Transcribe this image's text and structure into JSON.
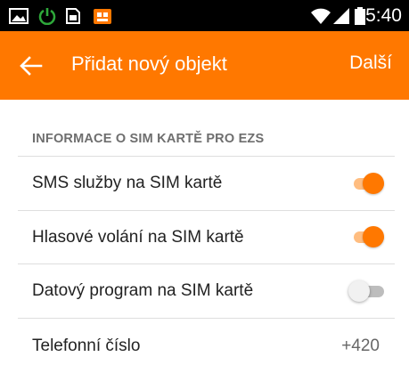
{
  "status_bar": {
    "time": "15:40",
    "icons": [
      "gallery-icon",
      "power-icon",
      "sim-icon",
      "security-icon",
      "wifi-icon",
      "signal-icon",
      "battery-icon"
    ]
  },
  "app_bar": {
    "title": "Přidat nový objekt",
    "action_label": "Další",
    "background_color": "#ff7800"
  },
  "section_header": "INFORMACE O SIM KARTĚ PRO EZS",
  "rows": [
    {
      "label": "SMS služby na SIM kartě",
      "enabled": true
    },
    {
      "label": "Hlasové volání na SIM kartě",
      "enabled": true
    },
    {
      "label": "Datový program na SIM kartě",
      "enabled": false
    }
  ],
  "phone_row": {
    "label": "Telefonní číslo",
    "value": "+420"
  }
}
